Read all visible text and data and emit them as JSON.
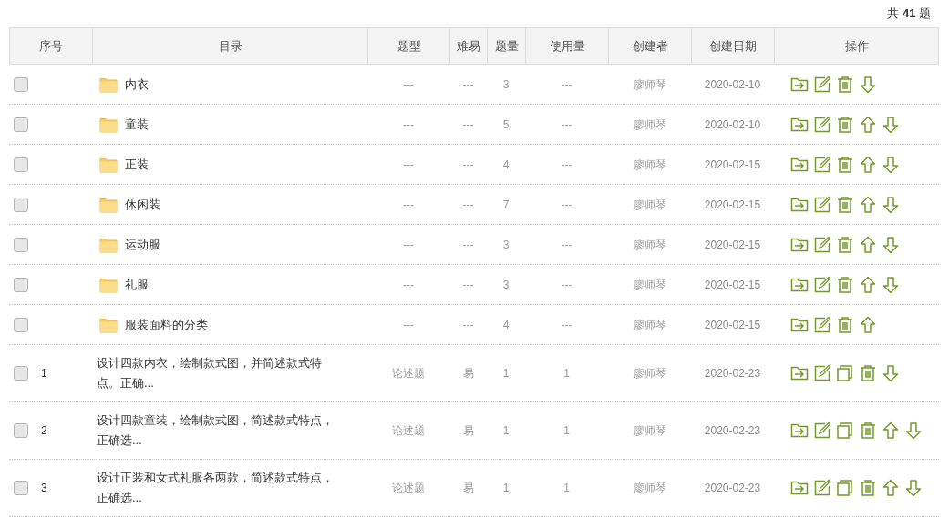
{
  "total": "共 **41** 题",
  "columns": [
    "序号",
    "目录",
    "题型",
    "难易",
    "题量",
    "使用量",
    "创建者",
    "创建日期",
    "操作"
  ],
  "rows": [
    {
      "kind": "folder",
      "checked": false,
      "title": "内衣",
      "type": "---",
      "difficulty": "---",
      "count": "3",
      "usage": "---",
      "creator": "廖师琴",
      "date": "2020-02-10",
      "actions": [
        {
          "kind": "move"
        },
        {
          "kind": "edit"
        },
        {
          "kind": "delete"
        },
        {
          "kind": "down"
        }
      ]
    },
    {
      "kind": "folder",
      "checked": false,
      "title": "童装",
      "type": "---",
      "difficulty": "---",
      "count": "5",
      "usage": "---",
      "creator": "廖师琴",
      "date": "2020-02-10",
      "actions": [
        {
          "kind": "move"
        },
        {
          "kind": "edit"
        },
        {
          "kind": "delete"
        },
        {
          "kind": "up"
        },
        {
          "kind": "down"
        }
      ]
    },
    {
      "kind": "folder",
      "checked": false,
      "title": "正装",
      "type": "---",
      "difficulty": "---",
      "count": "4",
      "usage": "---",
      "creator": "廖师琴",
      "date": "2020-02-15",
      "actions": [
        {
          "kind": "move"
        },
        {
          "kind": "edit"
        },
        {
          "kind": "delete"
        },
        {
          "kind": "up"
        },
        {
          "kind": "down"
        }
      ]
    },
    {
      "kind": "folder",
      "checked": false,
      "title": "休闲装",
      "type": "---",
      "difficulty": "---",
      "count": "7",
      "usage": "---",
      "creator": "廖师琴",
      "date": "2020-02-15",
      "actions": [
        {
          "kind": "move"
        },
        {
          "kind": "edit"
        },
        {
          "kind": "delete"
        },
        {
          "kind": "up"
        },
        {
          "kind": "down"
        }
      ]
    },
    {
      "kind": "folder",
      "checked": false,
      "title": "运动服",
      "type": "---",
      "difficulty": "---",
      "count": "3",
      "usage": "---",
      "creator": "廖师琴",
      "date": "2020-02-15",
      "actions": [
        {
          "kind": "move"
        },
        {
          "kind": "edit"
        },
        {
          "kind": "delete"
        },
        {
          "kind": "up"
        },
        {
          "kind": "down"
        }
      ]
    },
    {
      "kind": "folder",
      "checked": false,
      "title": "礼服",
      "type": "---",
      "difficulty": "---",
      "count": "3",
      "usage": "---",
      "creator": "廖师琴",
      "date": "2020-02-15",
      "actions": [
        {
          "kind": "move"
        },
        {
          "kind": "edit"
        },
        {
          "kind": "delete"
        },
        {
          "kind": "up"
        },
        {
          "kind": "down"
        }
      ]
    },
    {
      "kind": "folder",
      "checked": false,
      "title": "服装面料的分类",
      "type": "---",
      "difficulty": "---",
      "count": "4",
      "usage": "---",
      "creator": "廖师琴",
      "date": "2020-02-15",
      "actions": [
        {
          "kind": "move"
        },
        {
          "kind": "edit"
        },
        {
          "kind": "delete"
        },
        {
          "kind": "up"
        }
      ]
    },
    {
      "kind": "question",
      "checked": false,
      "index": "1",
      "title": "设计四款内衣，绘制款式图，并简述款式特点。正确...",
      "type": "论述题",
      "difficulty": "易",
      "count": "1",
      "usage": "1",
      "creator": "廖师琴",
      "date": "2020-02-23",
      "actions": [
        {
          "kind": "move"
        },
        {
          "kind": "edit"
        },
        {
          "kind": "copy"
        },
        {
          "kind": "delete"
        },
        {
          "kind": "down"
        }
      ]
    },
    {
      "kind": "question",
      "checked": false,
      "index": "2",
      "title": "设计四款童装，绘制款式图，简述款式特点，正确选...",
      "type": "论述题",
      "difficulty": "易",
      "count": "1",
      "usage": "1",
      "creator": "廖师琴",
      "date": "2020-02-23",
      "actions": [
        {
          "kind": "move"
        },
        {
          "kind": "edit"
        },
        {
          "kind": "copy"
        },
        {
          "kind": "delete"
        },
        {
          "kind": "up"
        },
        {
          "kind": "down"
        }
      ]
    },
    {
      "kind": "question",
      "checked": false,
      "index": "3",
      "title": "设计正装和女式礼服各两款，简述款式特点，正确选...",
      "type": "论述题",
      "difficulty": "易",
      "count": "1",
      "usage": "1",
      "creator": "廖师琴",
      "date": "2020-02-23",
      "actions": [
        {
          "kind": "move"
        },
        {
          "kind": "edit"
        },
        {
          "kind": "copy"
        },
        {
          "kind": "delete"
        },
        {
          "kind": "up"
        },
        {
          "kind": "down"
        }
      ]
    }
  ]
}
